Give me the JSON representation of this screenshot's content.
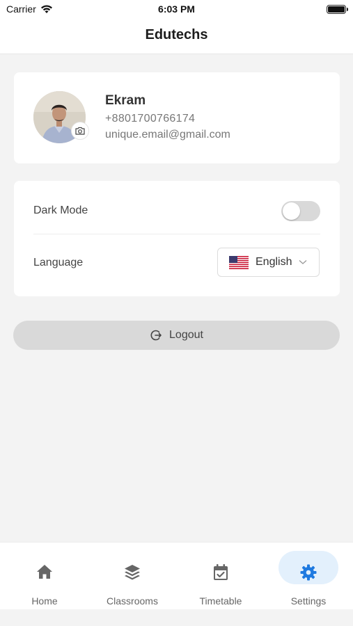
{
  "status_bar": {
    "carrier": "Carrier",
    "time": "6:03 PM"
  },
  "header": {
    "title": "Edutechs"
  },
  "profile": {
    "name": "Ekram",
    "phone": "+8801700766174",
    "email": "unique.email@gmail.com",
    "avatar_icon": "profile-photo",
    "camera_icon": "camera-icon"
  },
  "settings": {
    "dark_mode_label": "Dark Mode",
    "dark_mode_on": false,
    "language_label": "Language",
    "language_value": "English",
    "language_flag": "us-flag-icon"
  },
  "logout": {
    "label": "Logout",
    "icon": "logout-icon"
  },
  "tabs": [
    {
      "label": "Home",
      "icon": "home-icon",
      "active": false
    },
    {
      "label": "Classrooms",
      "icon": "layers-icon",
      "active": false
    },
    {
      "label": "Timetable",
      "icon": "calendar-check-icon",
      "active": false
    },
    {
      "label": "Settings",
      "icon": "gear-icon",
      "active": true
    }
  ],
  "colors": {
    "accent": "#1f7ae0",
    "active_tab_bg": "#e3f0fc",
    "inactive_icon": "#666666",
    "background": "#f3f3f3"
  }
}
